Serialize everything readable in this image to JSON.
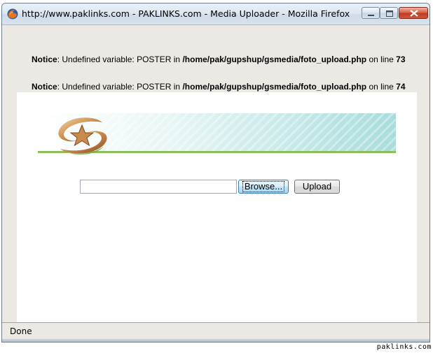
{
  "window": {
    "title": "http://www.paklinks.com - PAKLINKS.com - Media Uploader - Mozilla Firefox",
    "app_icon": "firefox-icon",
    "controls": {
      "minimize_icon": "minimize-icon",
      "maximize_icon": "maximize-icon",
      "close_icon": "close-icon"
    }
  },
  "notices": [
    {
      "label": "Notice",
      "text_before": ": Undefined variable: POSTER in ",
      "path": "/home/pak/gupshup/gsmedia/foto_upload.php",
      "text_after": " on line ",
      "line": "73"
    },
    {
      "label": "Notice",
      "text_before": ": Undefined variable: POSTER in ",
      "path": "/home/pak/gupshup/gsmedia/foto_upload.php",
      "text_after": " on line ",
      "line": "74"
    }
  ],
  "uploader": {
    "file_value": "",
    "browse_label": "Browse...",
    "upload_label": "Upload"
  },
  "status": {
    "text": "Done"
  },
  "watermark": "paklinks.com",
  "colors": {
    "banner_line": "#8cbf5a",
    "banner_teal": "#a8dcdc",
    "close_button": "#c13b1e"
  }
}
